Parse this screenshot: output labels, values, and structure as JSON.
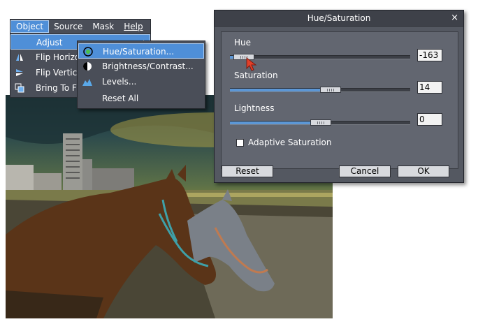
{
  "menubar": {
    "items": [
      {
        "label": "Object",
        "active": true
      },
      {
        "label": "Source"
      },
      {
        "label": "Mask"
      },
      {
        "label": "Help"
      }
    ]
  },
  "object_menu": {
    "items": [
      {
        "label": "Adjust",
        "icon": "none"
      },
      {
        "label": "Flip Horizo",
        "icon": "flip-horizontal-icon"
      },
      {
        "label": "Flip Vertical",
        "icon": "flip-vertical-icon"
      },
      {
        "label": "Bring To Fr",
        "icon": "bring-to-front-icon"
      }
    ]
  },
  "adjust_submenu": {
    "items": [
      {
        "label": "Hue/Saturation...",
        "icon": "hue-saturation-icon"
      },
      {
        "label": "Brightness/Contrast...",
        "icon": "brightness-contrast-icon"
      },
      {
        "label": "Levels...",
        "icon": "levels-icon"
      },
      {
        "label": "Reset All",
        "icon": "none"
      }
    ]
  },
  "dialog": {
    "title": "Hue/Saturation",
    "close": "×",
    "sliders": [
      {
        "label": "Hue",
        "value": "-163",
        "fraction": 0.08
      },
      {
        "label": "Saturation",
        "value": "14",
        "fraction": 0.55
      },
      {
        "label": "Lightness",
        "value": "0",
        "fraction": 0.5
      }
    ],
    "adaptive_label": "Adaptive Saturation",
    "adaptive_checked": false,
    "buttons": {
      "reset": "Reset",
      "cancel": "Cancel",
      "ok": "OK"
    }
  },
  "colors": {
    "accent": "#4f8fd8",
    "panel": "#545861",
    "track_fill": "#5c97d6"
  }
}
